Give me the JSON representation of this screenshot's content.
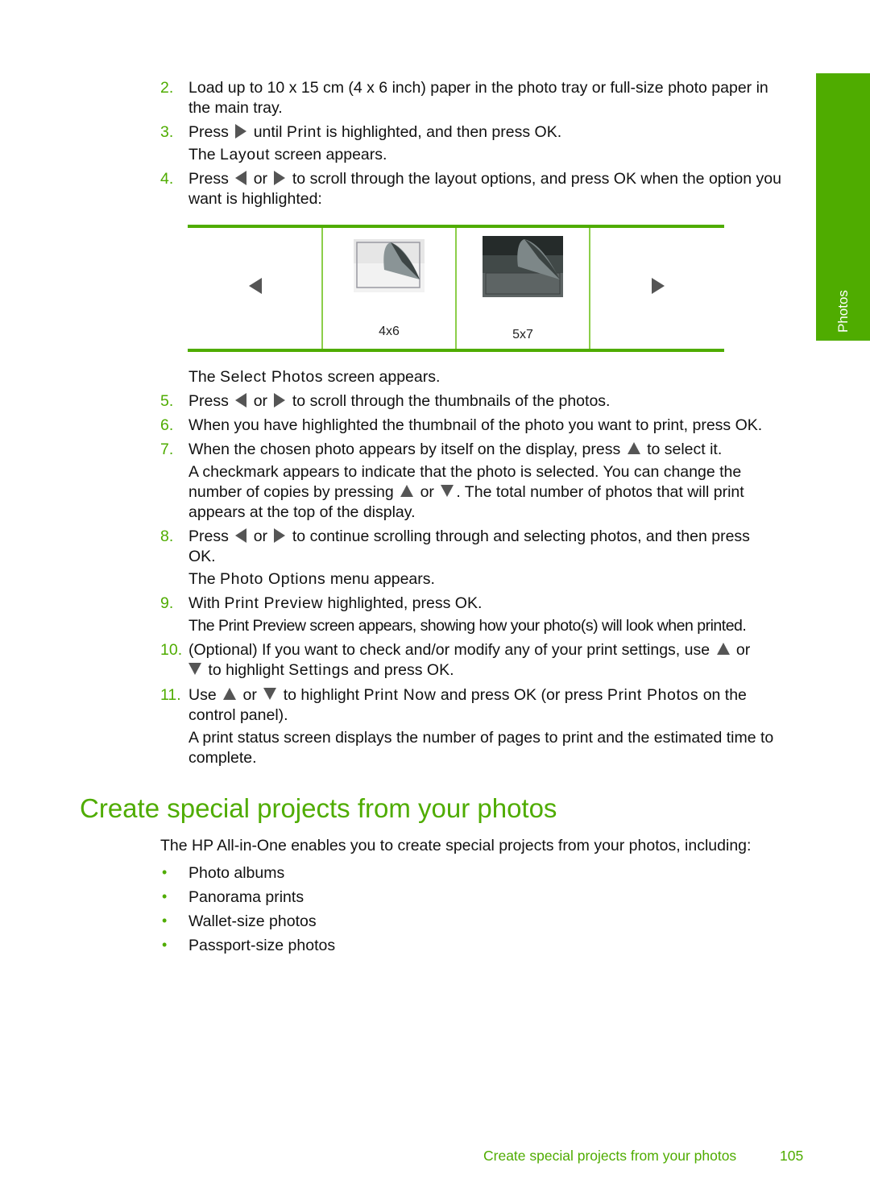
{
  "side_tab": {
    "label": "Photos",
    "color": "#4fac00"
  },
  "steps": [
    {
      "num": "2.",
      "lines": [
        "Load up to 10 x 15 cm (4 x 6 inch) paper in the photo tray or full-size photo paper in",
        "the main tray."
      ]
    },
    {
      "num": "3.",
      "line1_a": "Press",
      "line1_b": "until",
      "line1_ui": "Print",
      "line1_c": "is highlighted, and then press OK.",
      "line2_a": "The",
      "line2_ui": "Layout",
      "line2_b": "screen appears."
    },
    {
      "num": "4.",
      "line1_a": "Press",
      "line1_or": "or",
      "line1_b": "to scroll through the layout options, and press OK when the option you",
      "line2": "want is highlighted:"
    },
    {
      "num": "5.",
      "pre_a": "The",
      "pre_ui": "Select Photos",
      "pre_b": "screen appears.",
      "a": "Press",
      "or": "or",
      "b": "to scroll through the thumbnails of the photos."
    },
    {
      "num": "6.",
      "text": "When you have highlighted the thumbnail of the photo you want to print, press OK."
    },
    {
      "num": "7.",
      "a": "When the chosen photo appears by itself on the display, press",
      "b": "to select it.",
      "p1": "A checkmark appears to indicate that the photo is selected. You can change the",
      "p2a": "number of copies by pressing",
      "p2or": "or",
      "p2b": ". The total number of photos that will print",
      "p3": "appears at the top of the display."
    },
    {
      "num": "8.",
      "a": "Press",
      "or": "or",
      "b": "to continue scrolling through and selecting photos, and then press",
      "c": "OK.",
      "p_a": "The",
      "p_ui": "Photo Options",
      "p_b": "menu appears."
    },
    {
      "num": "9.",
      "a": "With",
      "ui": "Print Preview",
      "b": "highlighted, press OK.",
      "p_a": "The",
      "p_ui": "Print Preview",
      "p_b": "screen appears, showing how your photo(s) will look when printed."
    },
    {
      "num": "10.",
      "a": "(Optional) If you want to check and/or modify any of your print settings, use",
      "or": "or",
      "b": "to highlight",
      "ui": "Settings",
      "c": "and press OK."
    },
    {
      "num": "11.",
      "a": "Use",
      "or": "or",
      "b": "to highlight",
      "ui": "Print Now",
      "c": "and press OK (or press",
      "ui2": "Print Photos",
      "d": "on the",
      "e": "control panel).",
      "p1": "A print status screen displays the number of pages to print and the estimated time to",
      "p2": "complete."
    }
  ],
  "layout_options": [
    {
      "label": "4x6",
      "icon": "photo-4x6-icon"
    },
    {
      "label": "5x7",
      "icon": "photo-5x7-icon"
    }
  ],
  "section": {
    "heading": "Create special projects from your photos",
    "intro": "The HP All-in-One enables you to create special projects from your photos, including:",
    "bullets": [
      "Photo albums",
      "Panorama prints",
      "Wallet-size photos",
      "Passport-size photos"
    ]
  },
  "footer": {
    "title": "Create special projects from your photos",
    "page": "105"
  }
}
